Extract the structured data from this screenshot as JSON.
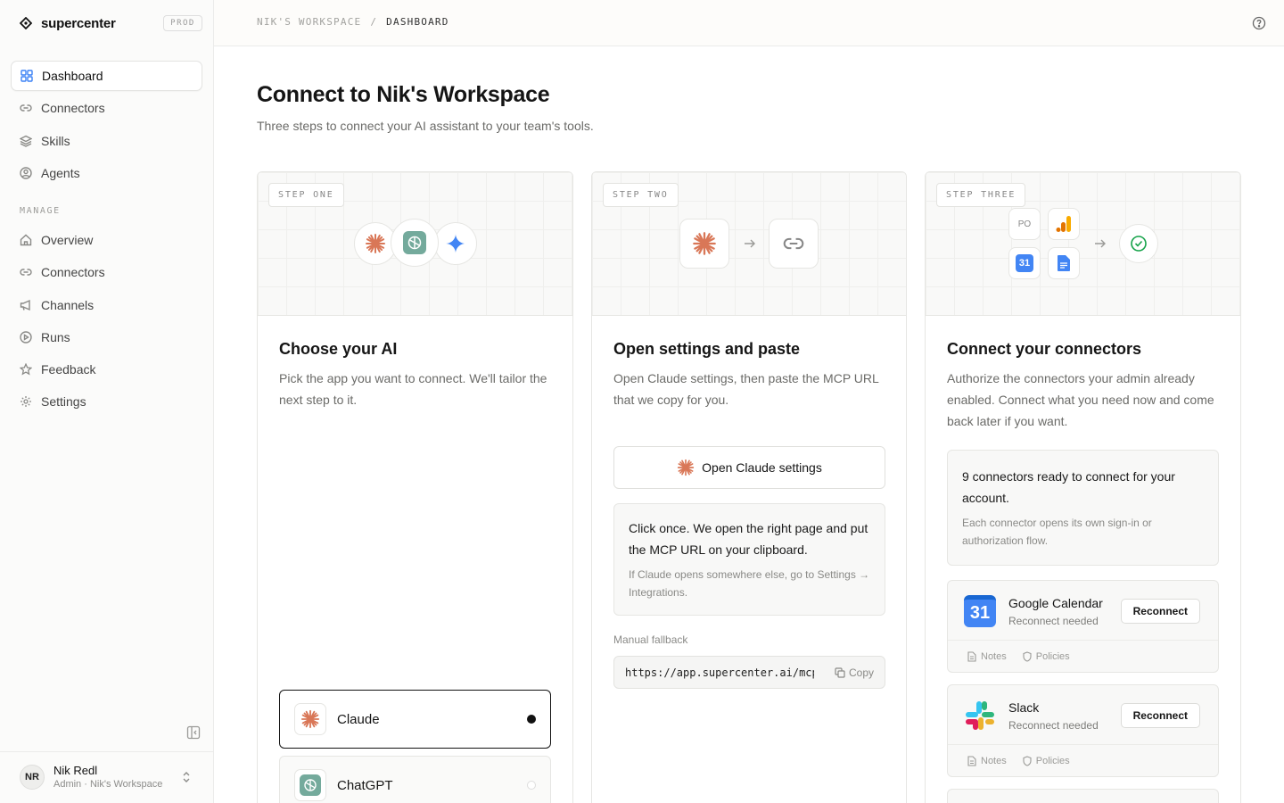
{
  "brand": {
    "name": "supercenter",
    "env": "PROD"
  },
  "nav": {
    "primary": [
      {
        "label": "Dashboard",
        "icon": "grid-icon",
        "active": true
      },
      {
        "label": "Connectors",
        "icon": "link-icon"
      },
      {
        "label": "Skills",
        "icon": "layers-icon"
      },
      {
        "label": "Agents",
        "icon": "user-circle-icon"
      }
    ],
    "section_label": "MANAGE",
    "manage": [
      {
        "label": "Overview",
        "icon": "home-icon"
      },
      {
        "label": "Connectors",
        "icon": "link-icon"
      },
      {
        "label": "Channels",
        "icon": "megaphone-icon"
      },
      {
        "label": "Runs",
        "icon": "play-circle-icon"
      },
      {
        "label": "Feedback",
        "icon": "star-icon"
      },
      {
        "label": "Settings",
        "icon": "gear-icon"
      }
    ]
  },
  "user": {
    "initials": "NR",
    "name": "Nik Redl",
    "subtitle": "Admin · Nik's Workspace"
  },
  "breadcrumb": {
    "workspace": "NIK'S WORKSPACE",
    "separator": "/",
    "current": "DASHBOARD"
  },
  "page": {
    "title": "Connect to Nik's Workspace",
    "subtitle": "Three steps to connect your AI assistant to your team's tools."
  },
  "steps": {
    "one": {
      "badge": "STEP ONE",
      "title": "Choose your AI",
      "description": "Pick the app you want to connect. We'll tailor the next step to it.",
      "options": [
        {
          "name": "Claude",
          "selected": true
        },
        {
          "name": "ChatGPT",
          "selected": false
        }
      ]
    },
    "two": {
      "badge": "STEP TWO",
      "title": "Open settings and paste",
      "description": "Open Claude settings, then paste the MCP URL that we copy for you.",
      "open_button": "Open Claude settings",
      "info_main": "Click once. We open the right page and put the MCP URL on your clipboard.",
      "info_note": "If Claude opens somewhere else, go to Settings → Integrations.",
      "fallback_label": "Manual fallback",
      "url": "https://app.supercenter.ai/mcp",
      "copy_label": "Copy"
    },
    "three": {
      "badge": "STEP THREE",
      "title": "Connect your connectors",
      "description": "Authorize the connectors your admin already enabled. Connect what you need now and come back later if you want.",
      "ready_main": "9 connectors ready to connect for your account.",
      "ready_note": "Each connector opens its own sign-in or authorization flow.",
      "po_label": "PO",
      "calendar_number": "31",
      "connectors": [
        {
          "name": "Google Calendar",
          "status": "Reconnect needed",
          "action": "Reconnect",
          "notes": "Notes",
          "policies": "Policies"
        },
        {
          "name": "Slack",
          "status": "Reconnect needed",
          "action": "Reconnect",
          "notes": "Notes",
          "policies": "Policies"
        }
      ]
    }
  },
  "colors": {
    "claude": "#d97757",
    "chatgpt": "#10a37f",
    "gemini": "#4285f4",
    "success": "#16a34a",
    "gcal_blue": "#4285f4",
    "accent_blue": "#3b82f6"
  }
}
